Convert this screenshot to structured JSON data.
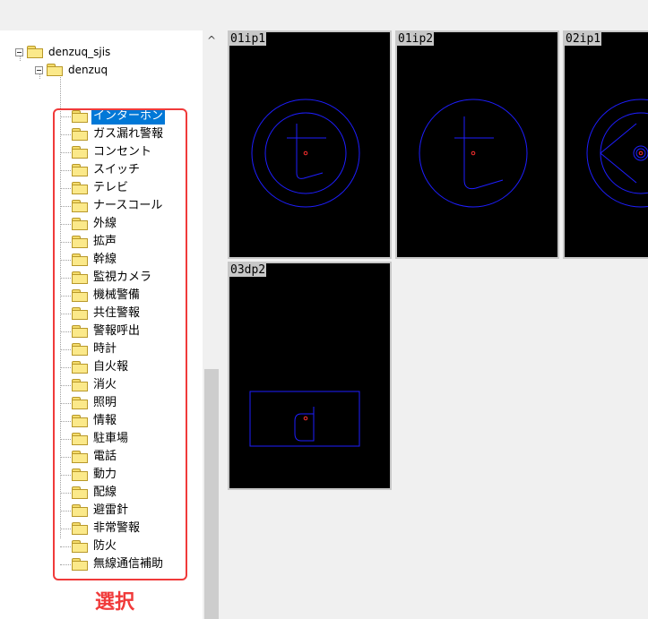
{
  "tree": {
    "root": "denzuq_sjis",
    "child": "denzuq",
    "items": [
      "インターホン",
      "ガス漏れ警報",
      "コンセント",
      "スイッチ",
      "テレビ",
      "ナースコール",
      "外線",
      "拡声",
      "幹線",
      "監視カメラ",
      "機械警備",
      "共住警報",
      "警報呼出",
      "時計",
      "自火報",
      "消火",
      "照明",
      "情報",
      "駐車場",
      "電話",
      "動力",
      "配線",
      "避雷針",
      "非常警報",
      "防火",
      "無線通信補助"
    ],
    "selected_index": 0
  },
  "annotation": {
    "caption": "選択",
    "color": "#f03a3a"
  },
  "scrollbar": {
    "up_arrow": "^"
  },
  "thumbnails": [
    {
      "name": "01ip1",
      "symbol": "intercom-t-circle-double"
    },
    {
      "name": "01ip2",
      "symbol": "intercom-t-circle"
    },
    {
      "name": "02ip1",
      "symbol": "speaker-circle"
    },
    {
      "name": "03dp2",
      "symbol": "d-rectangle"
    }
  ],
  "colors": {
    "selection": "#0078d7",
    "symbol_line": "#1e1eff",
    "origin_dot": "#ff3030"
  }
}
